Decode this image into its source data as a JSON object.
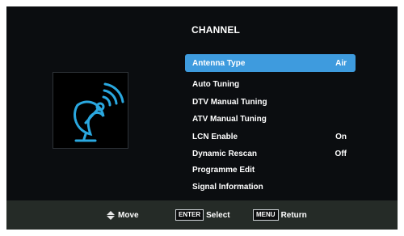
{
  "menu": {
    "title": "CHANNEL",
    "icon": "satellite-dish-icon",
    "accent_color": "#3e9bde",
    "icon_color": "#2aa8e0",
    "items": [
      {
        "label": "Antenna Type",
        "value": "Air",
        "selected": true
      },
      {
        "label": "Auto Tuning",
        "value": ""
      },
      {
        "label": "DTV Manual Tuning",
        "value": ""
      },
      {
        "label": "ATV Manual Tuning",
        "value": ""
      },
      {
        "label": "LCN Enable",
        "value": "On"
      },
      {
        "label": "Dynamic Rescan",
        "value": "Off"
      },
      {
        "label": "Programme Edit",
        "value": ""
      },
      {
        "label": "Signal Information",
        "value": ""
      }
    ]
  },
  "footer": {
    "move_icon": "up-down-arrows-icon",
    "move_label": "Move",
    "enter_key": "ENTER",
    "select_label": "Select",
    "menu_key": "MENU",
    "return_label": "Return"
  }
}
